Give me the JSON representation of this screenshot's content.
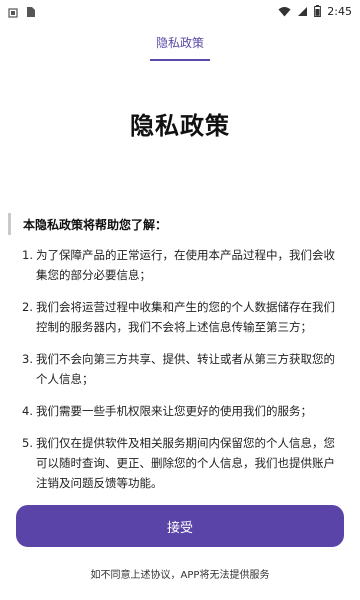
{
  "status_bar": {
    "time": "2:45",
    "left_icons": [
      "notification-icon",
      "sim-icon"
    ],
    "right_icons": [
      "wifi-icon",
      "signal-icon",
      "battery-icon"
    ]
  },
  "header": {
    "tab_title": "隐私政策",
    "accent_color": "#5a4aa8"
  },
  "main": {
    "title": "隐私政策",
    "intro": "本隐私政策将帮助您了解：",
    "items": [
      {
        "num": "1.",
        "text": "为了保障产品的正常运行，在使用本产品过程中，我们会收集您的部分必要信息；"
      },
      {
        "num": "2.",
        "text": "我们会将运营过程中收集和产生的您的个人数据储存在我们控制的服务器内，我们不会将上述信息传输至第三方；"
      },
      {
        "num": "3.",
        "text": "我们不会向第三方共享、提供、转让或者从第三方获取您的个人信息；"
      },
      {
        "num": "4.",
        "text": "我们需要一些手机权限来让您更好的使用我们的服务；"
      },
      {
        "num": "5.",
        "text": "我们仅在提供软件及相关服务期间内保留您的个人信息，您可以随时查询、更正、删除您的个人信息，我们也提供账户注销及问题反馈等功能。"
      }
    ]
  },
  "actions": {
    "accept_label": "接受",
    "button_color": "#5a44a8",
    "footer_note": "如不同意上述协议，APP将无法提供服务"
  }
}
